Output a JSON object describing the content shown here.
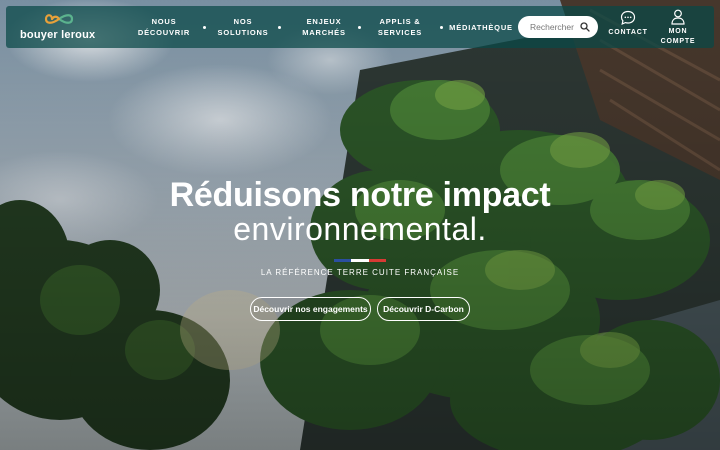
{
  "brand": {
    "name": "bouyer leroux",
    "colors": {
      "orange": "#e8a13a",
      "green": "#5bb38e",
      "nav_bg": "#084846"
    }
  },
  "nav": {
    "items": [
      {
        "label": "Nous découvrir"
      },
      {
        "label": "Nos solutions"
      },
      {
        "label": "Enjeux marchés"
      },
      {
        "label": "Applis & services"
      },
      {
        "label": "Médiathèque"
      }
    ],
    "search": {
      "placeholder": "Rechercher",
      "icon": "search-icon"
    },
    "contact": {
      "label": "Contact",
      "icon": "chat-bubble-icon"
    },
    "account": {
      "label": "Mon compte",
      "icon": "user-icon"
    }
  },
  "hero": {
    "title_line1": "Réduisons notre impact",
    "title_line2": "environnemental.",
    "tagline": "La référence terre cuite française",
    "flag_colors": [
      "#2b4fa0",
      "#ffffff",
      "#d83a34"
    ],
    "buttons": [
      {
        "label": "Découvrir nos engagements"
      },
      {
        "label": "Découvrir D-Carbon"
      }
    ]
  }
}
